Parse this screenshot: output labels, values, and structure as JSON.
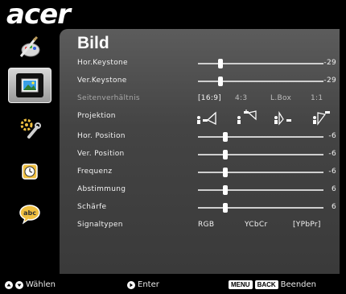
{
  "brand": "acer",
  "page_title": "Bild",
  "sidebar": [
    {
      "icon": "color-palette-icon",
      "active": false
    },
    {
      "icon": "picture-icon",
      "active": true
    },
    {
      "icon": "gear-wrench-icon",
      "active": false
    },
    {
      "icon": "clock-icon",
      "active": false
    },
    {
      "icon": "language-bubble-icon",
      "active": false
    }
  ],
  "rows": {
    "hor_keystone": {
      "label": "Hor.Keystone",
      "value": "-29",
      "level": 0.18
    },
    "ver_keystone": {
      "label": "Ver.Keystone",
      "value": "-29",
      "level": 0.18
    },
    "aspect": {
      "label": "Seitenverhältnis",
      "options": [
        "[16:9]",
        "4:3",
        "L.Box",
        "1:1"
      ]
    },
    "projection": {
      "label": "Projektion"
    },
    "hor_position": {
      "label": "Hor. Position",
      "value": "-6",
      "level": 0.22
    },
    "ver_position": {
      "label": "Ver. Position",
      "value": "-6",
      "level": 0.22
    },
    "frequency": {
      "label": "Frequenz",
      "value": "-6",
      "level": 0.22
    },
    "tracking": {
      "label": "Abstimmung",
      "value": "6",
      "level": 0.22
    },
    "sharpness": {
      "label": "Schärfe",
      "value": "6",
      "level": 0.22
    },
    "signal": {
      "label": "Signaltypen",
      "options": [
        "RGB",
        "YCbCr",
        "[YPbPr]"
      ]
    }
  },
  "bottom": {
    "select": "Wählen",
    "enter": "Enter",
    "menu_key": "MENU",
    "back_key": "BACK",
    "exit": "Beenden"
  }
}
